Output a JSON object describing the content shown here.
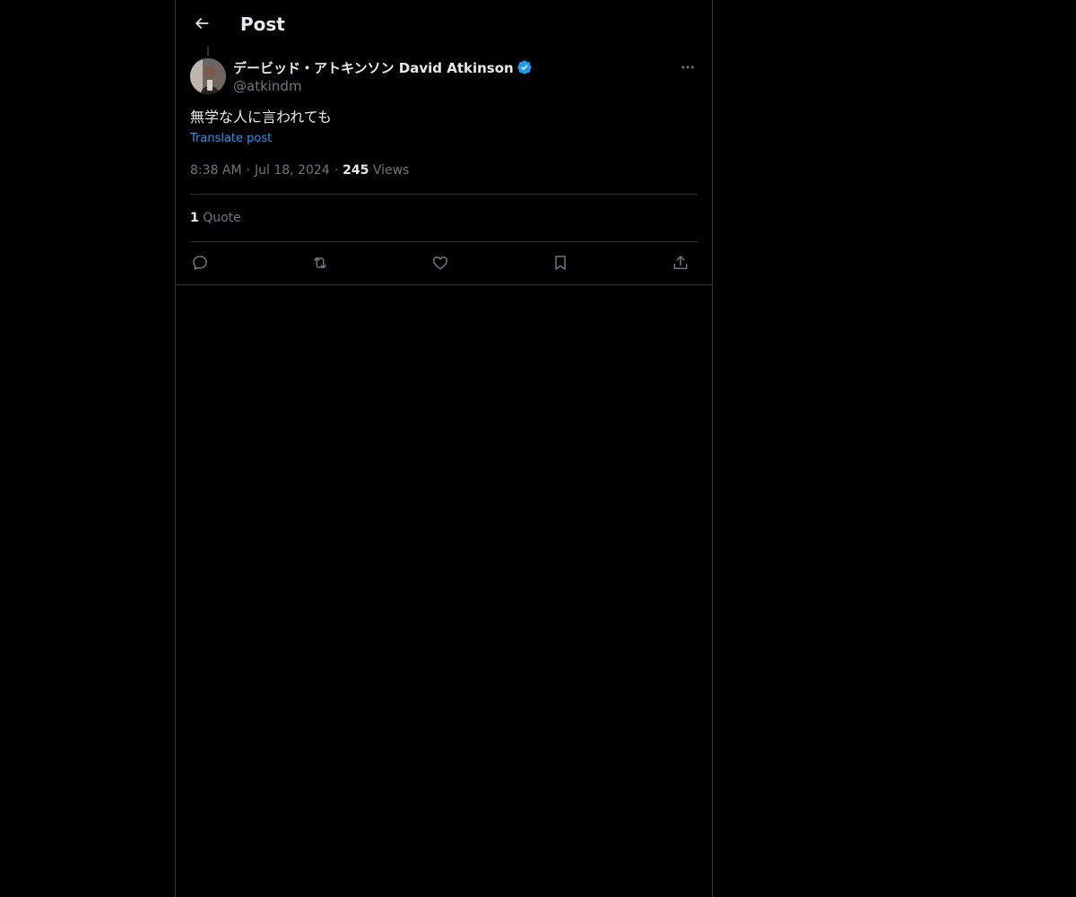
{
  "header": {
    "title": "Post",
    "back_icon": "arrow-left-icon"
  },
  "post": {
    "author": {
      "display_name": "デービッド・アトキンソン David Atkinson",
      "handle": "@atkindm",
      "verified": true,
      "verified_color": "#1d9bf0"
    },
    "text": "無学な人に言われても",
    "translate_label": "Translate post",
    "time": "8:38 AM",
    "date": "Jul 18, 2024",
    "views_count": "245",
    "views_label": "Views",
    "quotes_count": "1",
    "quotes_label": "Quote"
  },
  "actions": [
    {
      "name": "reply",
      "icon": "reply-icon"
    },
    {
      "name": "repost",
      "icon": "repost-icon"
    },
    {
      "name": "like",
      "icon": "heart-icon"
    },
    {
      "name": "bookmark",
      "icon": "bookmark-icon"
    },
    {
      "name": "share",
      "icon": "share-icon"
    }
  ],
  "colors": {
    "background": "#000000",
    "text_primary": "#e7e9ea",
    "text_secondary": "#71767b",
    "accent": "#1d9bf0",
    "border": "#2f3336"
  }
}
